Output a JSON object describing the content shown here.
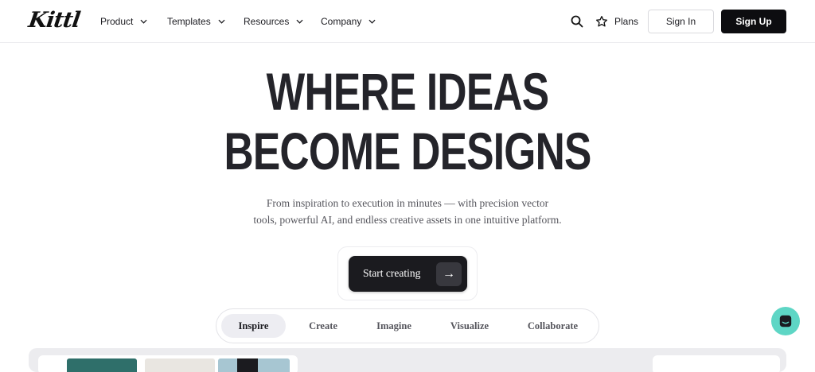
{
  "brand": {
    "logo": "Kittl"
  },
  "nav": {
    "menu": [
      "Product",
      "Templates",
      "Resources",
      "Company"
    ],
    "plans_label": "Plans",
    "sign_in": "Sign In",
    "sign_up": "Sign Up"
  },
  "hero": {
    "headline_line1": "WHERE IDEAS",
    "headline_line2": "BECOME DESIGNS",
    "subtitle_line1": "From inspiration to execution in minutes — with precision vector",
    "subtitle_line2": "tools, powerful AI, and endless creative assets in one intuitive platform.",
    "cta_label": "Start creating",
    "cta_arrow": "→"
  },
  "tabs": {
    "items": [
      "Inspire",
      "Create",
      "Imagine",
      "Visualize",
      "Collaborate"
    ],
    "active": "Inspire"
  },
  "colors": {
    "primary_dark": "#0d0d10",
    "chat_accent": "#5ed6c5",
    "active_tab_bg": "#ededf2"
  },
  "icons": [
    "search-icon",
    "star-icon",
    "chevron-down-icon",
    "arrow-right-icon",
    "chat-icon"
  ]
}
